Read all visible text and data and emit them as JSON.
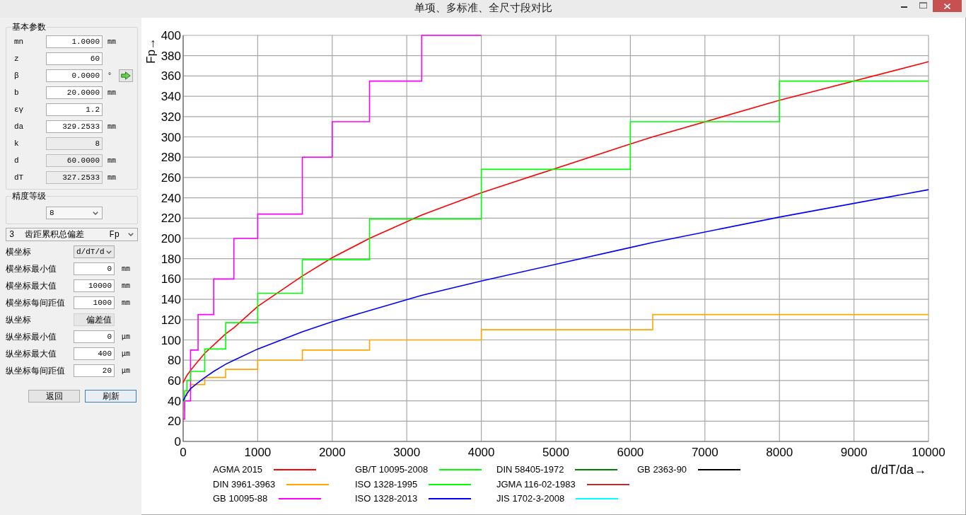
{
  "window": {
    "title": "单项、多标准、全尺寸段对比"
  },
  "basic_params": {
    "title": "基本参数",
    "rows": [
      {
        "kind": "field",
        "label": "mn",
        "value": "1.0000",
        "unit": "mm",
        "disabled": false
      },
      {
        "kind": "field",
        "label": "z",
        "value": "60",
        "disabled": false
      },
      {
        "kind": "field_with_button",
        "label": "β",
        "value": "0.0000",
        "unit": "°",
        "disabled": false
      },
      {
        "kind": "field",
        "label": "b",
        "value": "20.0000",
        "unit": "mm",
        "disabled": false
      },
      {
        "kind": "field",
        "label": "εγ",
        "value": "1.2",
        "disabled": false
      },
      {
        "kind": "field",
        "label": "da",
        "value": "329.2533",
        "unit": "mm",
        "disabled": false
      },
      {
        "kind": "field",
        "label": "k",
        "value": "8",
        "disabled": true
      },
      {
        "kind": "field",
        "label": "d",
        "value": "60.0000",
        "unit": "mm",
        "disabled": true
      },
      {
        "kind": "field",
        "label": "dT",
        "value": "327.2533",
        "unit": "mm",
        "disabled": true
      }
    ]
  },
  "accuracy_grade": {
    "title": "精度等级",
    "value": "8"
  },
  "deviation_type": {
    "value": "3  齿距累积总偏差     Fp"
  },
  "axis_settings": [
    {
      "kind": "select",
      "label": "横坐标",
      "value": "d/dT/d"
    },
    {
      "kind": "input",
      "label": "横坐标最小值",
      "value": "0",
      "unit": "mm"
    },
    {
      "kind": "input",
      "label": "横坐标最大值",
      "value": "10000",
      "unit": "mm"
    },
    {
      "kind": "input",
      "label": "横坐标每间距值",
      "value": "1000",
      "unit": "mm"
    },
    {
      "kind": "button",
      "label": "纵坐标",
      "value": "偏差值"
    },
    {
      "kind": "input",
      "label": "纵坐标最小值",
      "value": "0",
      "unit": "μm"
    },
    {
      "kind": "input",
      "label": "纵坐标最大值",
      "value": "400",
      "unit": "μm"
    },
    {
      "kind": "input",
      "label": "纵坐标每间距值",
      "value": "20",
      "unit": "μm"
    }
  ],
  "buttons": [
    {
      "label": "返回",
      "focused": false
    },
    {
      "label": "刷新",
      "focused": true
    }
  ],
  "plot": {
    "chart_data": {
      "type": "line",
      "xlabel": "d/dT/da→",
      "ylabel": "Fp→",
      "grid": true,
      "legend": "bottom",
      "xlim": [
        0,
        10000
      ],
      "ylim": [
        0,
        400
      ],
      "xticks": [
        {
          "value": 0,
          "label": "0"
        },
        {
          "value": 1000,
          "label": "1000"
        },
        {
          "value": 2000,
          "label": "2000"
        },
        {
          "value": 3000,
          "label": "3000"
        },
        {
          "value": 4000,
          "label": "4000"
        },
        {
          "value": 5000,
          "label": "5000"
        },
        {
          "value": 6000,
          "label": "6000"
        },
        {
          "value": 7000,
          "label": "7000"
        },
        {
          "value": 8000,
          "label": "8000"
        },
        {
          "value": 9000,
          "label": "9000"
        },
        {
          "value": 10000,
          "label": "10000"
        }
      ],
      "yticks": [
        {
          "value": 0,
          "label": "0"
        },
        {
          "value": 20,
          "label": "20"
        },
        {
          "value": 40,
          "label": "40"
        },
        {
          "value": 60,
          "label": "60"
        },
        {
          "value": 80,
          "label": "80"
        },
        {
          "value": 100,
          "label": "100"
        },
        {
          "value": 120,
          "label": "120"
        },
        {
          "value": 140,
          "label": "140"
        },
        {
          "value": 160,
          "label": "160"
        },
        {
          "value": 180,
          "label": "180"
        },
        {
          "value": 200,
          "label": "200"
        },
        {
          "value": 220,
          "label": "220"
        },
        {
          "value": 240,
          "label": "240"
        },
        {
          "value": 260,
          "label": "260"
        },
        {
          "value": 280,
          "label": "280"
        },
        {
          "value": 300,
          "label": "300"
        },
        {
          "value": 320,
          "label": "320"
        },
        {
          "value": 340,
          "label": "340"
        },
        {
          "value": 360,
          "label": "360"
        },
        {
          "value": 380,
          "label": "380"
        },
        {
          "value": 400,
          "label": "400"
        }
      ],
      "x": [
        0,
        20,
        20,
        50,
        50,
        100,
        100,
        200,
        200,
        290,
        290,
        410,
        410,
        570,
        570,
        680,
        680,
        1000,
        1000,
        1600,
        1600,
        2000,
        2000,
        2500,
        2500,
        3200,
        3200,
        4000,
        4000,
        6000,
        6000,
        6300,
        6300,
        8000,
        8000,
        10000
      ],
      "series": [
        {
          "name": "AGMA 2015",
          "color": "#ff0000",
          "values": [
            58,
            61,
            61,
            65,
            65,
            70,
            70,
            79,
            79,
            87,
            87,
            95,
            95,
            106,
            106,
            112,
            112,
            133,
            133,
            163,
            163,
            181,
            181,
            200,
            200,
            223,
            223,
            245,
            245,
            293,
            293,
            300,
            300,
            336,
            336,
            374
          ]
        },
        {
          "name": "DIN 3961-3963",
          "color": "#ffa500",
          "values": [
            30,
            30,
            45,
            45,
            50,
            50,
            56,
            56,
            56,
            56,
            63,
            63,
            63,
            63,
            71,
            71,
            71,
            71,
            80,
            80,
            90,
            90,
            90,
            90,
            100,
            100,
            100,
            100,
            110,
            110,
            110,
            110,
            125,
            125,
            125,
            125
          ]
        },
        {
          "name": "GB 10095-88",
          "color": "#ff00ff",
          "values": [
            22,
            22,
            40,
            40,
            40,
            40,
            90,
            90,
            125,
            125,
            125,
            125,
            160,
            160,
            160,
            160,
            200,
            200,
            224,
            224,
            280,
            280,
            315,
            315,
            355,
            355,
            400,
            400,
            null,
            null,
            null,
            null,
            null,
            null,
            null,
            null
          ]
        },
        {
          "name": "GB/T 10095-2008",
          "color": "#00ff00",
          "values": [
            null,
            null,
            null,
            null,
            null,
            null,
            null,
            null,
            null,
            null,
            null,
            null,
            null,
            null,
            null,
            null,
            null,
            null,
            null,
            null,
            null,
            null,
            null,
            null,
            null,
            null,
            null,
            null,
            null,
            null,
            null,
            null,
            null,
            null,
            null,
            null
          ]
        },
        {
          "name": "ISO 1328-1995",
          "color": "#00ff00",
          "values": [
            40,
            40,
            50,
            50,
            60,
            60,
            69,
            69,
            69,
            69,
            91,
            91,
            91,
            91,
            117,
            117,
            117,
            117,
            146,
            146,
            179,
            179,
            179,
            179,
            219,
            219,
            219,
            219,
            268,
            268,
            315,
            315,
            315,
            315,
            355,
            355
          ]
        },
        {
          "name": "ISO 1328-2013",
          "color": "#0000ff",
          "values": [
            40,
            43,
            43,
            47,
            47,
            52,
            52,
            58,
            58,
            63,
            63,
            69,
            69,
            76,
            76,
            80,
            80,
            91,
            91,
            108,
            108,
            118,
            118,
            129,
            129,
            144,
            144,
            158,
            158,
            191,
            191,
            196,
            196,
            221,
            221,
            248
          ]
        },
        {
          "name": "DIN 58405-1972",
          "color": "#008000",
          "values": [
            null,
            null,
            null,
            null,
            null,
            null,
            null,
            null,
            null,
            null,
            null,
            null,
            null,
            null,
            null,
            null,
            null,
            null,
            null,
            null,
            null,
            null,
            null,
            null,
            null,
            null,
            null,
            null,
            null,
            null,
            null,
            null,
            null,
            null,
            null,
            null
          ]
        },
        {
          "name": "JGMA 116-02-1983",
          "color": "#b03030",
          "values": [
            null,
            null,
            null,
            null,
            null,
            null,
            null,
            null,
            null,
            null,
            null,
            null,
            null,
            null,
            null,
            null,
            null,
            null,
            null,
            null,
            null,
            null,
            null,
            null,
            null,
            null,
            null,
            null,
            null,
            null,
            null,
            null,
            null,
            null,
            null,
            null
          ]
        },
        {
          "name": "JIS 1702-3-2008",
          "color": "#00ffff",
          "values": [
            null,
            null,
            null,
            null,
            null,
            null,
            null,
            null,
            null,
            null,
            null,
            null,
            null,
            null,
            null,
            null,
            null,
            null,
            null,
            null,
            null,
            null,
            null,
            null,
            null,
            null,
            null,
            null,
            null,
            null,
            null,
            null,
            null,
            null,
            null,
            null
          ]
        },
        {
          "name": "GB 2363-90",
          "color": "#000000",
          "values": [
            null,
            null,
            null,
            null,
            null,
            null,
            null,
            null,
            null,
            null,
            null,
            null,
            null,
            null,
            null,
            null,
            null,
            null,
            null,
            null,
            null,
            null,
            null,
            null,
            null,
            null,
            null,
            null,
            null,
            null,
            null,
            null,
            null,
            null,
            null,
            null
          ]
        }
      ]
    }
  }
}
